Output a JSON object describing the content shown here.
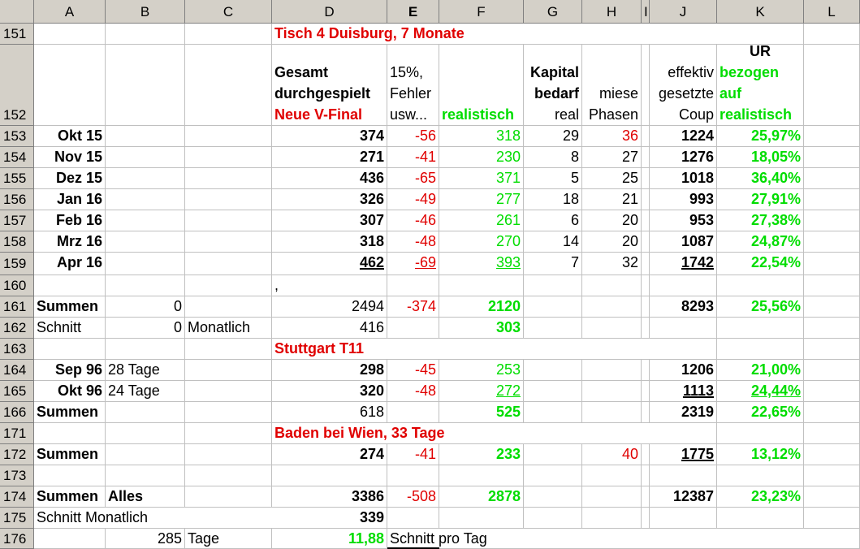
{
  "columns": [
    "A",
    "B",
    "C",
    "D",
    "E",
    "F",
    "G",
    "H",
    "I",
    "J",
    "K",
    "L"
  ],
  "selected_column": "E",
  "rows": {
    "r151": {
      "num": "151",
      "d": "Tisch 4 Duisburg, 7 Monate"
    },
    "r152": {
      "num": "152",
      "d1": "Gesamt",
      "d2": "durchgespielt",
      "d3": "Neue V-Final",
      "e1": "15%,",
      "e2": "Fehler",
      "e3": "usw...",
      "f1": "realistisch",
      "g1": "Kapital",
      "g2": "bedarf",
      "g3": "real",
      "h1": "miese",
      "h2": "Phasen",
      "j1": "effektiv",
      "j2": "gesetzte",
      "j3": "Coup",
      "k1": "UR",
      "k2": "bezogen",
      "k3": "auf",
      "k4": "realistisch"
    },
    "r153": {
      "num": "153",
      "a": "Okt 15",
      "d": "374",
      "e": "-56",
      "f": "318",
      "g": "29",
      "h": "36",
      "j": "1224",
      "k": "25,97%"
    },
    "r154": {
      "num": "154",
      "a": "Nov 15",
      "d": "271",
      "e": "-41",
      "f": "230",
      "g": "8",
      "h": "27",
      "j": "1276",
      "k": "18,05%"
    },
    "r155": {
      "num": "155",
      "a": "Dez 15",
      "d": "436",
      "e": "-65",
      "f": "371",
      "g": "5",
      "h": "25",
      "j": "1018",
      "k": "36,40%"
    },
    "r156": {
      "num": "156",
      "a": "Jan 16",
      "d": "326",
      "e": "-49",
      "f": "277",
      "g": "18",
      "h": "21",
      "j": "993",
      "k": "27,91%"
    },
    "r157": {
      "num": "157",
      "a": "Feb 16",
      "d": "307",
      "e": "-46",
      "f": "261",
      "g": "6",
      "h": "20",
      "j": "953",
      "k": "27,38%"
    },
    "r158": {
      "num": "158",
      "a": "Mrz 16",
      "d": "318",
      "e": "-48",
      "f": "270",
      "g": "14",
      "h": "20",
      "j": "1087",
      "k": "24,87%"
    },
    "r159": {
      "num": "159",
      "a": "Apr 16",
      "d": "462",
      "e": "-69 ",
      "f": "393",
      "g": "7",
      "h": "32",
      "j": "1742",
      "k": "22,54%"
    },
    "r160": {
      "num": "160",
      "d": ","
    },
    "r161": {
      "num": "161",
      "a": "Summen",
      "b": "0",
      "d": "2494",
      "e": "-374",
      "f": "2120",
      "j": "8293",
      "k": "25,56%"
    },
    "r162": {
      "num": "162",
      "a": "Schnitt",
      "b": "0",
      "c": "Monatlich",
      "d": "416",
      "f": "303"
    },
    "r163": {
      "num": "163",
      "d": "Stuttgart T11"
    },
    "r164": {
      "num": "164",
      "a": "Sep 96",
      "b": "28 Tage",
      "d": "298",
      "e": "-45",
      "f": "253",
      "j": "1206",
      "k": "21,00%"
    },
    "r165": {
      "num": "165",
      "a": "Okt 96",
      "b": "24 Tage",
      "d": "320",
      "e": "-48",
      "f": "272",
      "j": "1113",
      "k": "24,44%"
    },
    "r166": {
      "num": "166",
      "a": "Summen",
      "d": "618",
      "f": "525",
      "j": "2319",
      "k": "22,65%"
    },
    "r171": {
      "num": "171",
      "d": "Baden bei Wien, 33 Tage"
    },
    "r172": {
      "num": "172",
      "a": "Summen",
      "d": "274",
      "e": "-41",
      "f": "233",
      "h": "40",
      "j": "1775",
      "k": "13,12%"
    },
    "r173": {
      "num": "173"
    },
    "r174": {
      "num": "174",
      "a": "Summen",
      "b": "Alles",
      "d": "3386",
      "e": "-508",
      "f": "2878",
      "j": "12387",
      "k": "23,23%"
    },
    "r175": {
      "num": "175",
      "a": "Schnitt Monatlich",
      "d": "339"
    },
    "r176": {
      "num": "176",
      "b": "285",
      "c": "Tage",
      "d": "11,88",
      "e": "Schnitt pro Tag"
    }
  },
  "colors": {
    "red": "#e00000",
    "green": "#00dd00",
    "header_gray": "#d4d0c8",
    "grid": "#c0c0c0"
  }
}
